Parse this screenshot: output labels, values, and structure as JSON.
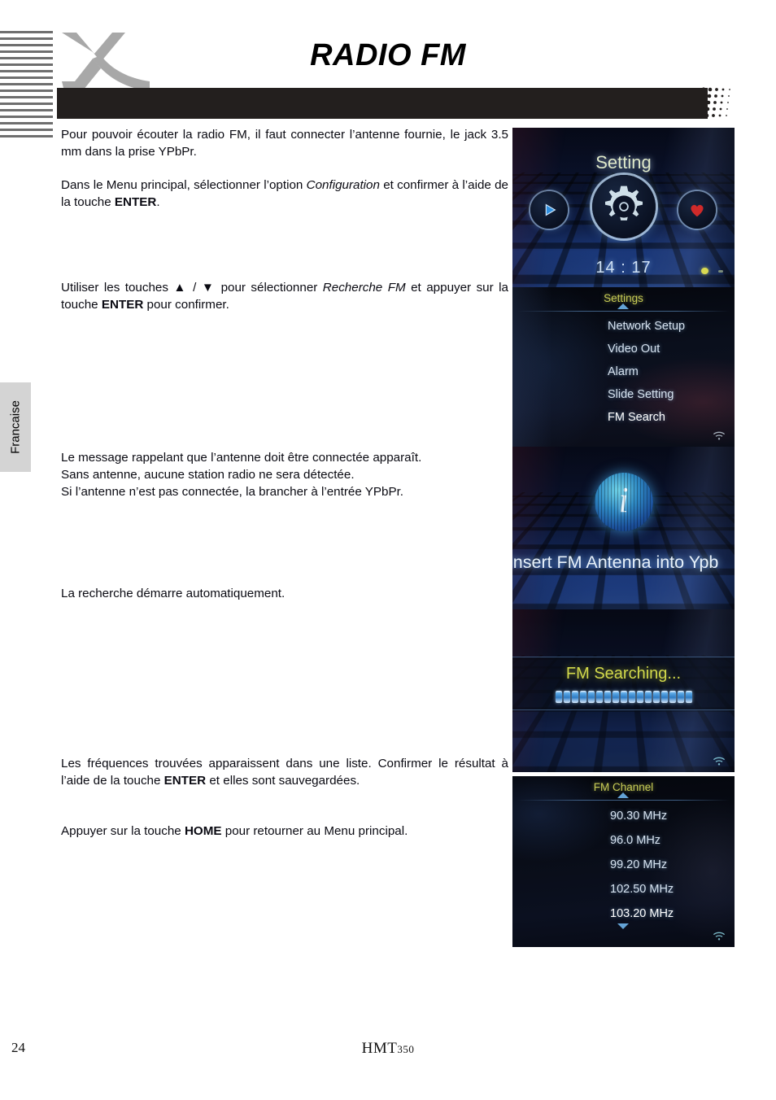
{
  "document": {
    "title": "RADIO FM",
    "logo_icon": "xoro-x-logo",
    "language_tab": "Francaise",
    "footer": {
      "page_number": "24",
      "model_name": "HMT",
      "model_number": "350"
    }
  },
  "body": {
    "paragraphs": [
      {
        "id": "p1",
        "runs": [
          {
            "text": "Pour pouvoir écouter la radio FM, il faut connecter l’antenne fournie, le jack 3.5 mm dans la prise YPbPr.",
            "style": "normal"
          }
        ]
      },
      {
        "id": "p2",
        "runs": [
          {
            "text": "Dans le Menu principal, sélectionner l’option ",
            "style": "normal"
          },
          {
            "text": "Configuration",
            "style": "italic"
          },
          {
            "text": " et confirmer à l’aide de la touche ",
            "style": "normal"
          },
          {
            "text": "ENTER",
            "style": "bold"
          },
          {
            "text": ".",
            "style": "normal"
          }
        ]
      },
      {
        "id": "p3",
        "runs": [
          {
            "text": "Utiliser les touches ▲ / ▼ pour sélectionner ",
            "style": "normal"
          },
          {
            "text": "Recherche FM",
            "style": "italic"
          },
          {
            "text": " et appuyer sur la touche ",
            "style": "normal"
          },
          {
            "text": "ENTER",
            "style": "bold"
          },
          {
            "text": " pour confirmer.",
            "style": "normal"
          }
        ]
      },
      {
        "id": "p4",
        "runs": [
          {
            "text": "Le message rappelant que l’antenne doit être connectée apparaît.",
            "style": "normal"
          },
          {
            "text": "BR",
            "style": "break"
          },
          {
            "text": "Sans antenne, aucune station radio ne sera détectée.",
            "style": "normal"
          },
          {
            "text": "BR",
            "style": "break"
          },
          {
            "text": "Si l’antenne n’est pas connectée, la brancher à l’entrée YPbPr.",
            "style": "normal"
          }
        ]
      },
      {
        "id": "p5",
        "runs": [
          {
            "text": "La recherche démarre automatiquement.",
            "style": "normal"
          }
        ]
      },
      {
        "id": "p6",
        "runs": [
          {
            "text": "Les fréquences trouvées apparaissent dans une liste. Confirmer le résultat à l’aide de la touche ",
            "style": "normal"
          },
          {
            "text": "ENTER",
            "style": "bold"
          },
          {
            "text": " et elles sont sauvegardées.",
            "style": "normal"
          }
        ]
      },
      {
        "id": "p7",
        "runs": [
          {
            "text": "Appuyer sur la touche ",
            "style": "normal"
          },
          {
            "text": "HOME",
            "style": "bold"
          },
          {
            "text": " pour retourner au Menu principal.",
            "style": "normal"
          }
        ]
      }
    ]
  },
  "screenshots": {
    "setting_home": {
      "title": "Setting",
      "clock": "14 : 17",
      "icons": [
        "play-icon",
        "gear-icon",
        "heart-icon"
      ],
      "status_dots": [
        "yellow",
        "gray"
      ]
    },
    "settings_menu": {
      "header": "Settings",
      "items": [
        {
          "label": "Network Setup",
          "selected": false
        },
        {
          "label": "Video Out",
          "selected": false
        },
        {
          "label": "Alarm",
          "selected": false
        },
        {
          "label": "Slide Setting",
          "selected": false
        },
        {
          "label": "FM Search",
          "selected": true
        }
      ]
    },
    "antenna_warning": {
      "icon": "info-icon",
      "message": "insert FM Antenna into Ypb"
    },
    "fm_searching": {
      "label": "FM Searching...",
      "progress_segments": 17
    },
    "fm_channel": {
      "header": "FM Channel",
      "items": [
        {
          "label": "90.30 MHz",
          "selected": false
        },
        {
          "label": "96.0 MHz",
          "selected": false
        },
        {
          "label": "99.20 MHz",
          "selected": false
        },
        {
          "label": "102.50 MHz",
          "selected": false
        },
        {
          "label": "103.20 MHz",
          "selected": true
        }
      ]
    }
  },
  "colors": {
    "header_bar": "#231f1e",
    "logo_gray": "#a8a8a8",
    "tab_gray": "#d4d4d4",
    "menu_header_yellow": "#c8cc56",
    "selected_blue": "#4a73af"
  }
}
